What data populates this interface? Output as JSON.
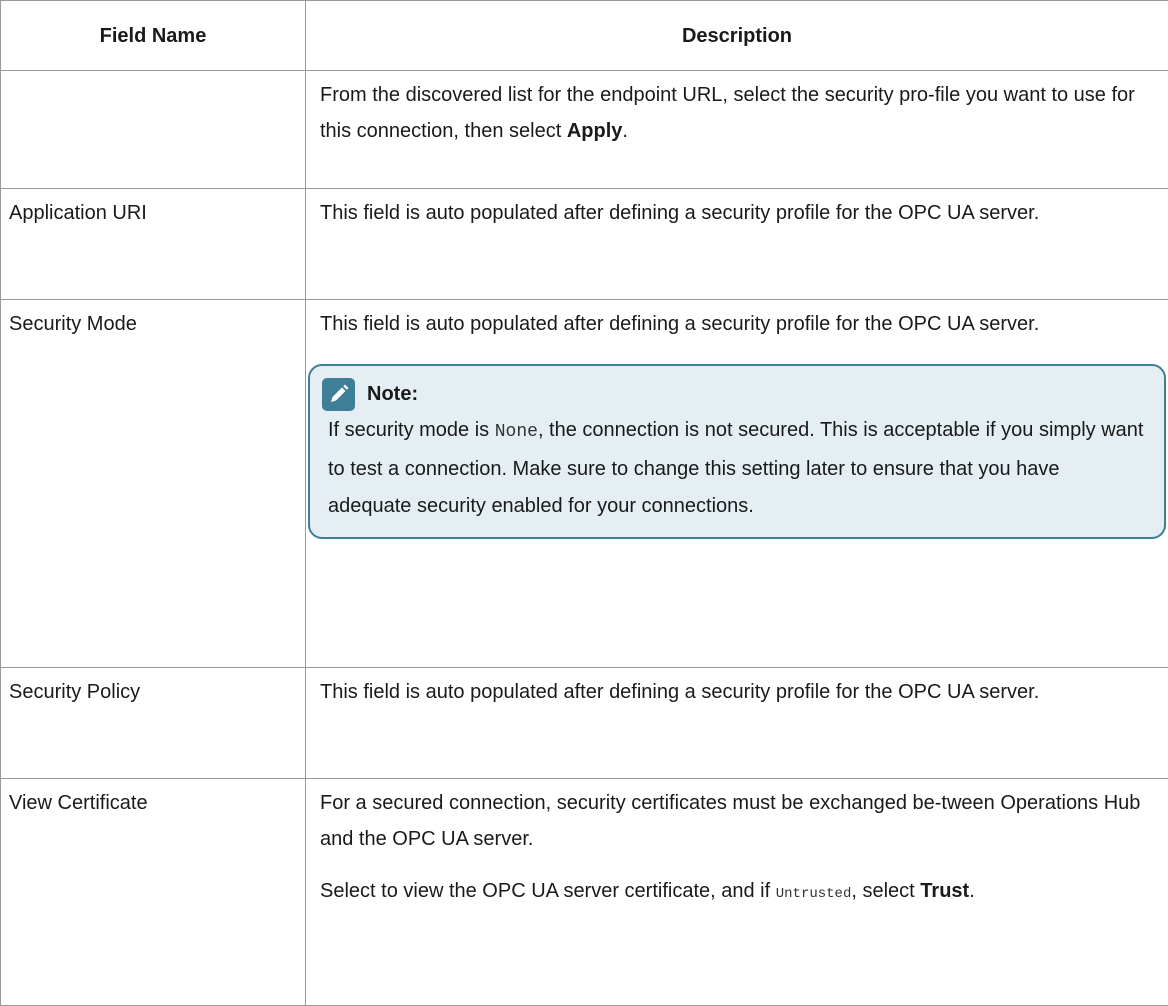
{
  "header": {
    "col1": "Field Name",
    "col2": "Description"
  },
  "rows": [
    {
      "field": "",
      "desc_prefix": "From the discovered list for the endpoint URL, select the security pro-file you want to use for this connection, then select ",
      "desc_bold": "Apply",
      "desc_suffix": "."
    },
    {
      "field": "Application URI",
      "desc": "This field is auto populated after defining a security profile for the OPC UA server."
    },
    {
      "field": "Security Mode",
      "desc": "This field is auto populated after defining a security profile for the OPC UA server.",
      "note": {
        "title": "Note:",
        "body_prefix": "If security mode is ",
        "body_code": "None",
        "body_suffix": ", the connection is not secured. This is acceptable if you simply want to test a connection. Make sure to change this setting later to ensure that you have adequate security enabled for your connections.",
        "icon": "note-pencil-icon"
      }
    },
    {
      "field": "Security Policy",
      "desc": "This field is auto populated after defining a security profile for the OPC UA server."
    },
    {
      "field": "View Certificate",
      "desc": "For a secured connection, security certificates must be exchanged be-tween Operations Hub and the OPC UA server.",
      "desc2_prefix": "Select to view the OPC UA server certificate, and if ",
      "desc2_code": "Untrusted",
      "desc2_mid": ", select ",
      "desc2_bold": "Trust",
      "desc2_suffix": "."
    }
  ],
  "colors": {
    "border": "#9a9a9a",
    "note_border": "#3e7f97",
    "note_bg": "#e5eef2",
    "icon_bg": "#3e7f97"
  }
}
